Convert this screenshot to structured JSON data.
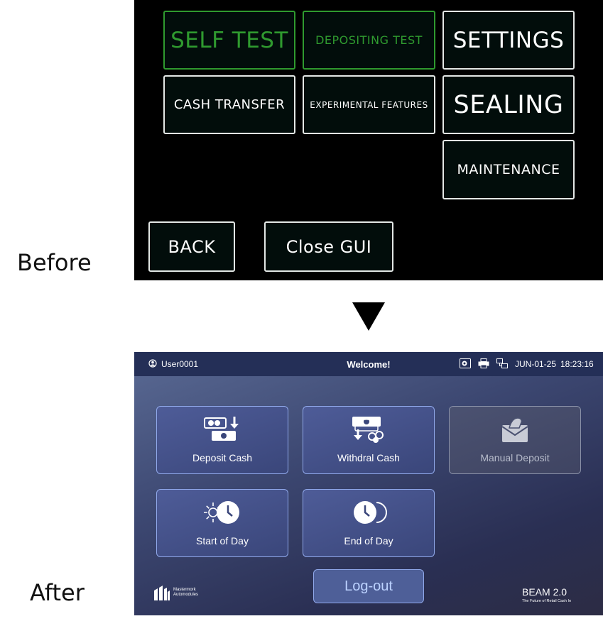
{
  "captions": {
    "before": "Before",
    "after": "After"
  },
  "before": {
    "self_test": "SELF TEST",
    "depositing_test": "DEPOSITING TEST",
    "settings": "SETTINGS",
    "cash_transfer": "CASH TRANSFER",
    "experimental_features": "EXPERIMENTAL FEATURES",
    "sealing": "SEALING",
    "maintenance": "MAINTENANCE",
    "back": "BACK",
    "close_gui": "Close GUI"
  },
  "after": {
    "topbar": {
      "user": "User0001",
      "welcome": "Welcome!",
      "date": "JUN-01-25",
      "time": "18:23:16"
    },
    "cards": {
      "deposit_cash": "Deposit Cash",
      "withdral_cash": "Withdral Cash",
      "manual_deposit": "Manual Deposit",
      "start_of_day": "Start of Day",
      "end_of_day": "End of Day"
    },
    "logout": "Log-out",
    "logo_text_1": "Mastermork",
    "logo_text_2": "Automodules",
    "brand": "BEAM 2.0",
    "tagline": "The Future of Retail Cash In"
  },
  "colors": {
    "green_accent": "#2f9a2f",
    "topbar_bg": "#242f57",
    "card_border": "#90a8ea",
    "logout_text": "#bcd2ff"
  }
}
